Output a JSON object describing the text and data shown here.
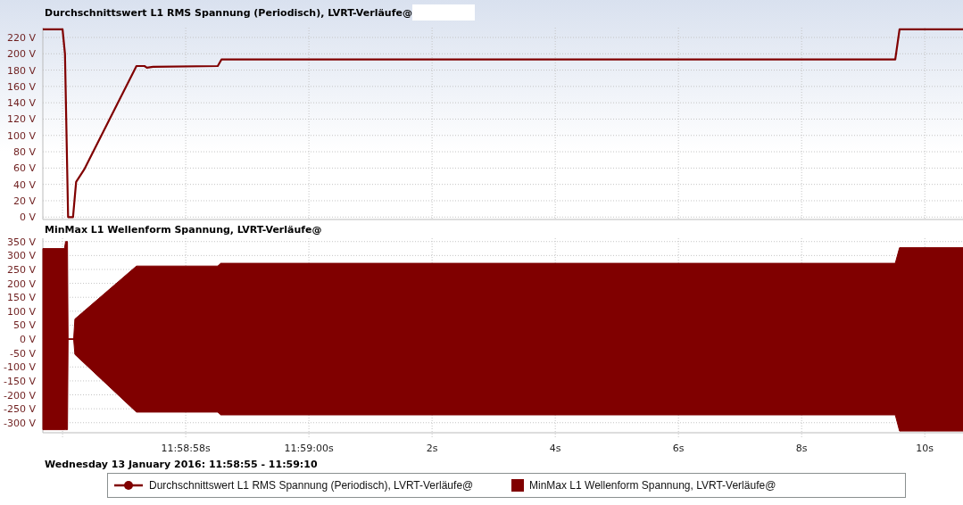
{
  "charts": [
    {
      "title": "Durchschnittswert L1 RMS Spannung (Periodisch), LVRT-Verläufe@",
      "chart_data": {
        "type": "line",
        "grid": true,
        "x": [
          -4.32,
          -4.0,
          -3.96,
          -3.91,
          -3.83,
          -3.78,
          -3.65,
          -2.8,
          -2.67,
          -2.63,
          -2.53,
          -1.48,
          -1.42,
          9.52,
          9.59,
          10.62
        ],
        "series": [
          {
            "name": "Durchschnittswert L1 RMS Spannung (Periodisch), LVRT-Verläufe@",
            "color": "#800000",
            "values": [
              230,
              230,
              200,
              0,
              0,
              43,
              58,
              185,
              185,
              183,
              184,
              185,
              193,
              193,
              230,
              230
            ]
          }
        ],
        "xlim": [
          -4.32,
          10.62
        ],
        "ylim": [
          -3,
          232
        ],
        "yticks": [
          {
            "value": 0,
            "label": "0 V"
          },
          {
            "value": 20,
            "label": "20 V"
          },
          {
            "value": 40,
            "label": "40 V"
          },
          {
            "value": 60,
            "label": "60 V"
          },
          {
            "value": 80,
            "label": "80 V"
          },
          {
            "value": 100,
            "label": "100 V"
          },
          {
            "value": 120,
            "label": "120 V"
          },
          {
            "value": 140,
            "label": "140 V"
          },
          {
            "value": 160,
            "label": "160 V"
          },
          {
            "value": 180,
            "label": "180 V"
          },
          {
            "value": 200,
            "label": "200 V"
          },
          {
            "value": 220,
            "label": "220 V"
          }
        ]
      }
    },
    {
      "title": "MinMax L1 Wellenform Spannung, LVRT-Verläufe@",
      "chart_data": {
        "type": "area",
        "grid": true,
        "x": [
          -4.32,
          -3.97,
          -3.95,
          -3.92,
          -3.91,
          -3.82,
          -3.8,
          -2.8,
          -1.48,
          -1.43,
          9.52,
          9.59,
          10.62
        ],
        "series": [
          {
            "name": "MinMax L1 Wellenform Spannung, LVRT-Verläufe@",
            "color": "#800000",
            "values": [
              325,
              325,
              350,
              350,
              0,
              0,
              72,
              262,
              262,
              272,
              272,
              328,
              328
            ]
          },
          {
            "color": "#800000",
            "values": [
              -325,
              -325,
              -325,
              -325,
              0,
              0,
              -55,
              -262,
              -262,
              -272,
              -272,
              -330,
              -330
            ]
          }
        ],
        "xlim": [
          -4.32,
          10.62
        ],
        "ylim": [
          -336,
          362
        ],
        "xticks": [
          {
            "value": -2,
            "label": "11:58:58s"
          },
          {
            "value": 0,
            "label": "11:59:00s"
          },
          {
            "value": 2,
            "label": "2s"
          },
          {
            "value": 4,
            "label": "4s"
          },
          {
            "value": 6,
            "label": "6s"
          },
          {
            "value": 8,
            "label": "8s"
          },
          {
            "value": 10,
            "label": "10s"
          }
        ],
        "yticks": [
          {
            "value": -300,
            "label": "-300 V"
          },
          {
            "value": -250,
            "label": "-250 V"
          },
          {
            "value": -200,
            "label": "-200 V"
          },
          {
            "value": -150,
            "label": "-150 V"
          },
          {
            "value": -100,
            "label": "-100 V"
          },
          {
            "value": -50,
            "label": "-50 V"
          },
          {
            "value": 0,
            "label": "0 V"
          },
          {
            "value": 50,
            "label": "50 V"
          },
          {
            "value": 100,
            "label": "100 V"
          },
          {
            "value": 150,
            "label": "150 V"
          },
          {
            "value": 200,
            "label": "200 V"
          },
          {
            "value": 250,
            "label": "250 V"
          },
          {
            "value": 300,
            "label": "300 V"
          },
          {
            "value": 350,
            "label": "350 V"
          }
        ]
      }
    }
  ],
  "date_range": "Wednesday 13 January 2016: 11:58:55 - 11:59:10",
  "legend": [
    {
      "kind": "line"
    },
    {
      "kind": "box"
    }
  ]
}
